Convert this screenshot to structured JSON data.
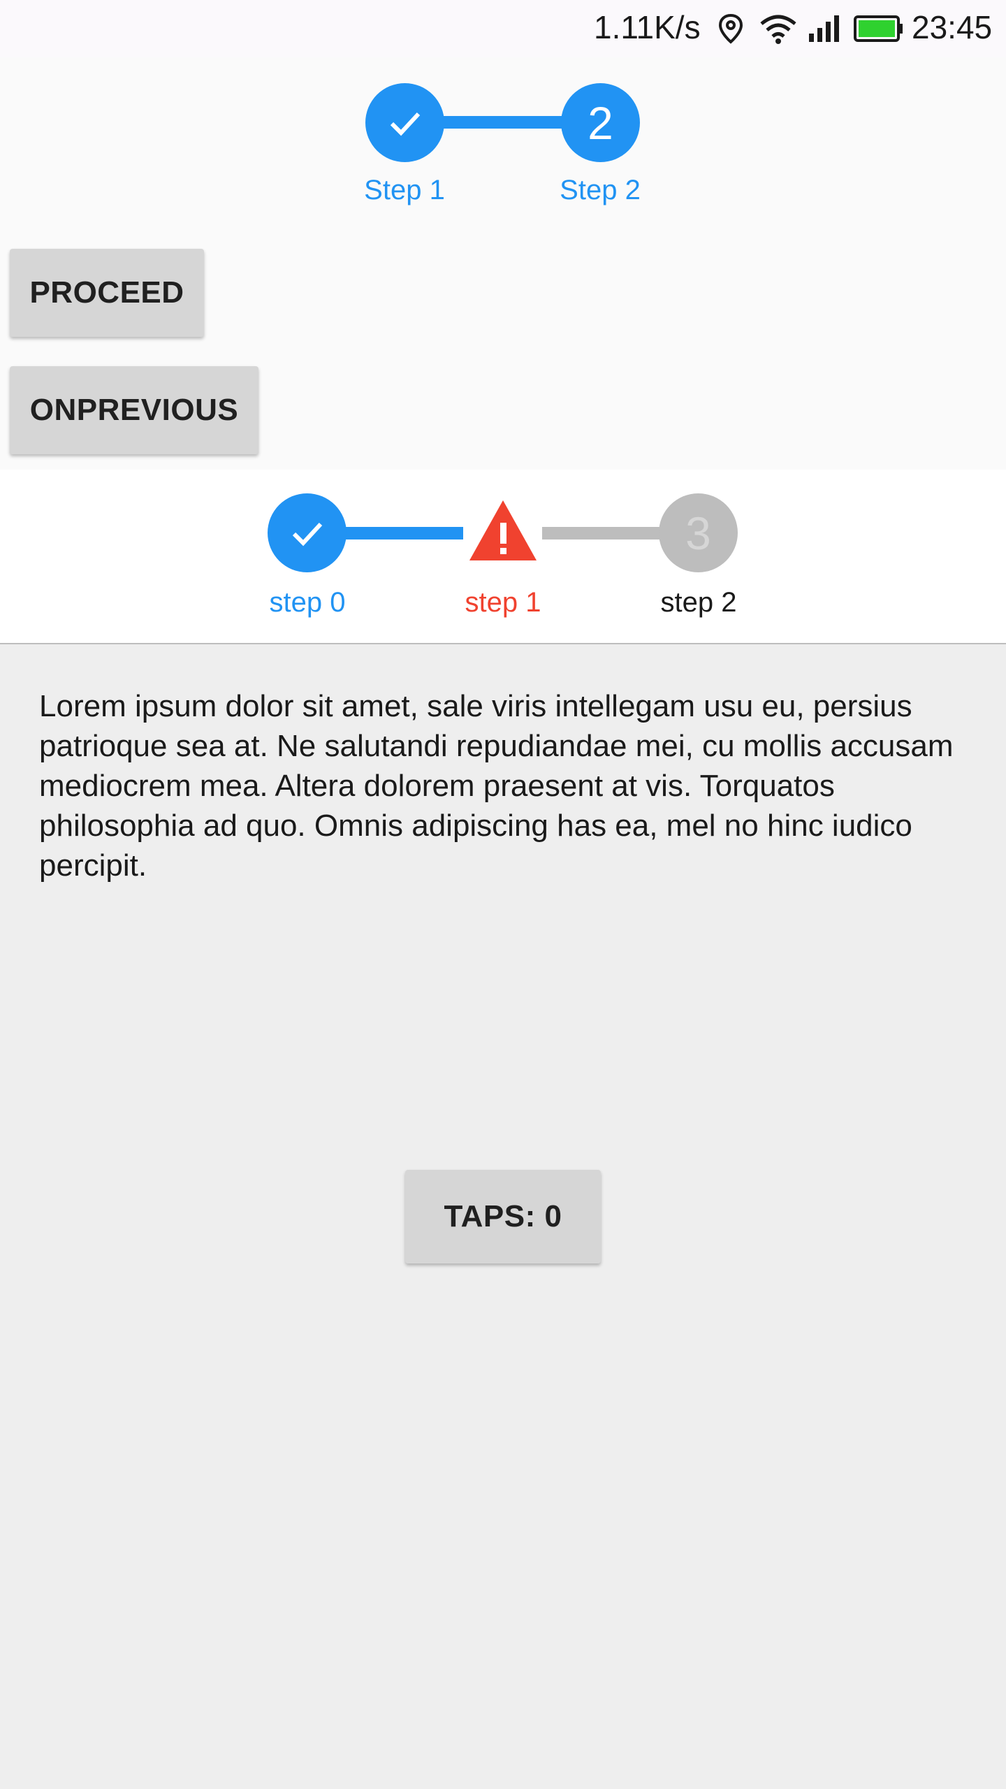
{
  "status_bar": {
    "network_speed": "1.11K/s",
    "time": "23:45",
    "icons": [
      "location-icon",
      "wifi-icon",
      "signal-icon",
      "battery-icon"
    ]
  },
  "stepper_top": {
    "steps": [
      {
        "label": "Step 1",
        "state": "completed",
        "icon": "check-icon"
      },
      {
        "label": "Step 2",
        "state": "active",
        "number": "2"
      }
    ],
    "color": "#2193f3"
  },
  "buttons": {
    "proceed_label": "PROCEED",
    "onprevious_label": "ONPREVIOUS",
    "taps_label": "TAPS: 0"
  },
  "stepper_bottom": {
    "steps": [
      {
        "label": "step 0",
        "state": "completed",
        "icon": "check-icon"
      },
      {
        "label": "step 1",
        "state": "error",
        "icon": "warning-icon"
      },
      {
        "label": "step 2",
        "state": "inactive",
        "number": "3"
      }
    ],
    "active_color": "#2193f3",
    "error_color": "#f0422f",
    "inactive_color": "#bdbdbd"
  },
  "content": {
    "lorem_text": "Lorem ipsum dolor sit amet, sale viris intellegam usu eu, persius patrioque sea at. Ne salutandi repudiandae mei, cu mollis accusam mediocrem mea. Altera dolorem praesent at vis. Torquatos philosophia ad quo. Omnis adipiscing has ea, mel no hinc iudico percipit."
  }
}
